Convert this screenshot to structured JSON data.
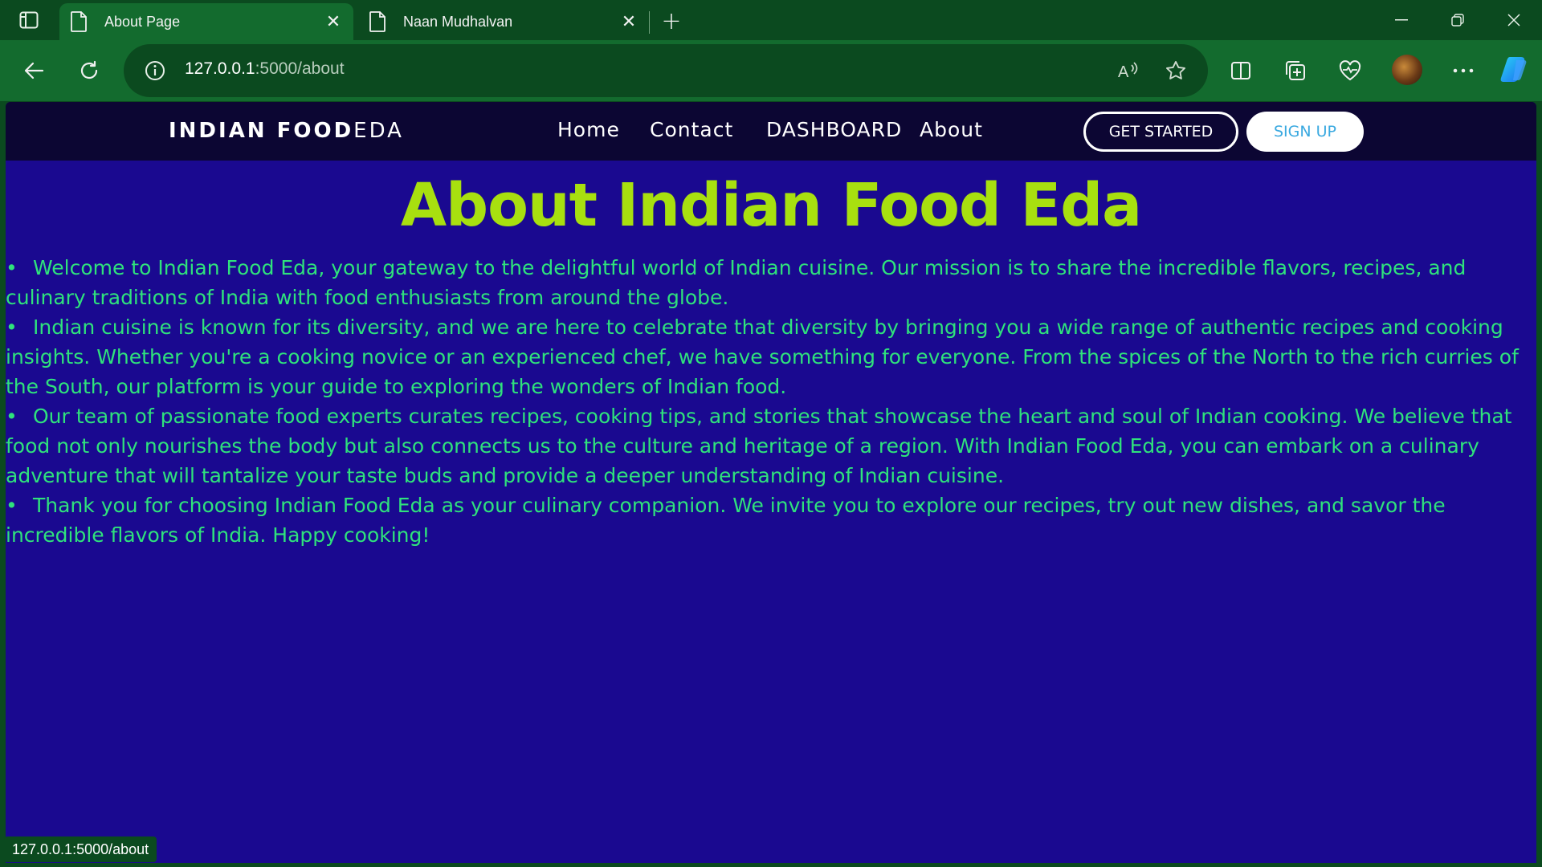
{
  "browser": {
    "tabs": [
      {
        "title": "About Page",
        "active": true
      },
      {
        "title": "Naan Mudhalvan",
        "active": false
      }
    ],
    "close_glyph": "✕",
    "new_tab_glyph": "+",
    "address": {
      "host": "127.0.0.1",
      "rest": ":5000/about"
    },
    "status_url": "127.0.0.1:5000/about"
  },
  "site": {
    "brand": {
      "bold": "INDIAN FOOD",
      "light": "EDA"
    },
    "nav": [
      "Home",
      "Contact",
      "DASHBOARD",
      "About"
    ],
    "get_started": "GET STARTED",
    "sign_up": "SIGN UP",
    "heading": "About Indian Food Eda",
    "paragraphs": [
      "Welcome to Indian Food Eda, your gateway to the delightful world of Indian cuisine. Our mission is to share the incredible flavors, recipes, and culinary traditions of India with food enthusiasts from around the globe.",
      "Indian cuisine is known for its diversity, and we are here to celebrate that diversity by bringing you a wide range of authentic recipes and cooking insights. Whether you're a cooking novice or an experienced chef, we have something for everyone. From the spices of the North to the rich curries of the South, our platform is your guide to exploring the wonders of Indian food.",
      "Our team of passionate food experts curates recipes, cooking tips, and stories that showcase the heart and soul of Indian cooking. We believe that food not only nourishes the body but also connects us to the culture and heritage of a region. With Indian Food Eda, you can embark on a culinary adventure that will tantalize your taste buds and provide a deeper understanding of Indian cuisine.",
      "Thank you for choosing Indian Food Eda as your culinary companion. We invite you to explore our recipes, try out new dishes, and savor the incredible flavors of India. Happy cooking!"
    ]
  },
  "colors": {
    "chrome_dark": "#0b4a1f",
    "chrome_light": "#136b2e",
    "page_bg": "#1a0990",
    "nav_bg": "#0c0633",
    "heading": "#a8e00f",
    "body_text": "#2fe27c",
    "signup_text": "#3aa9e0"
  }
}
